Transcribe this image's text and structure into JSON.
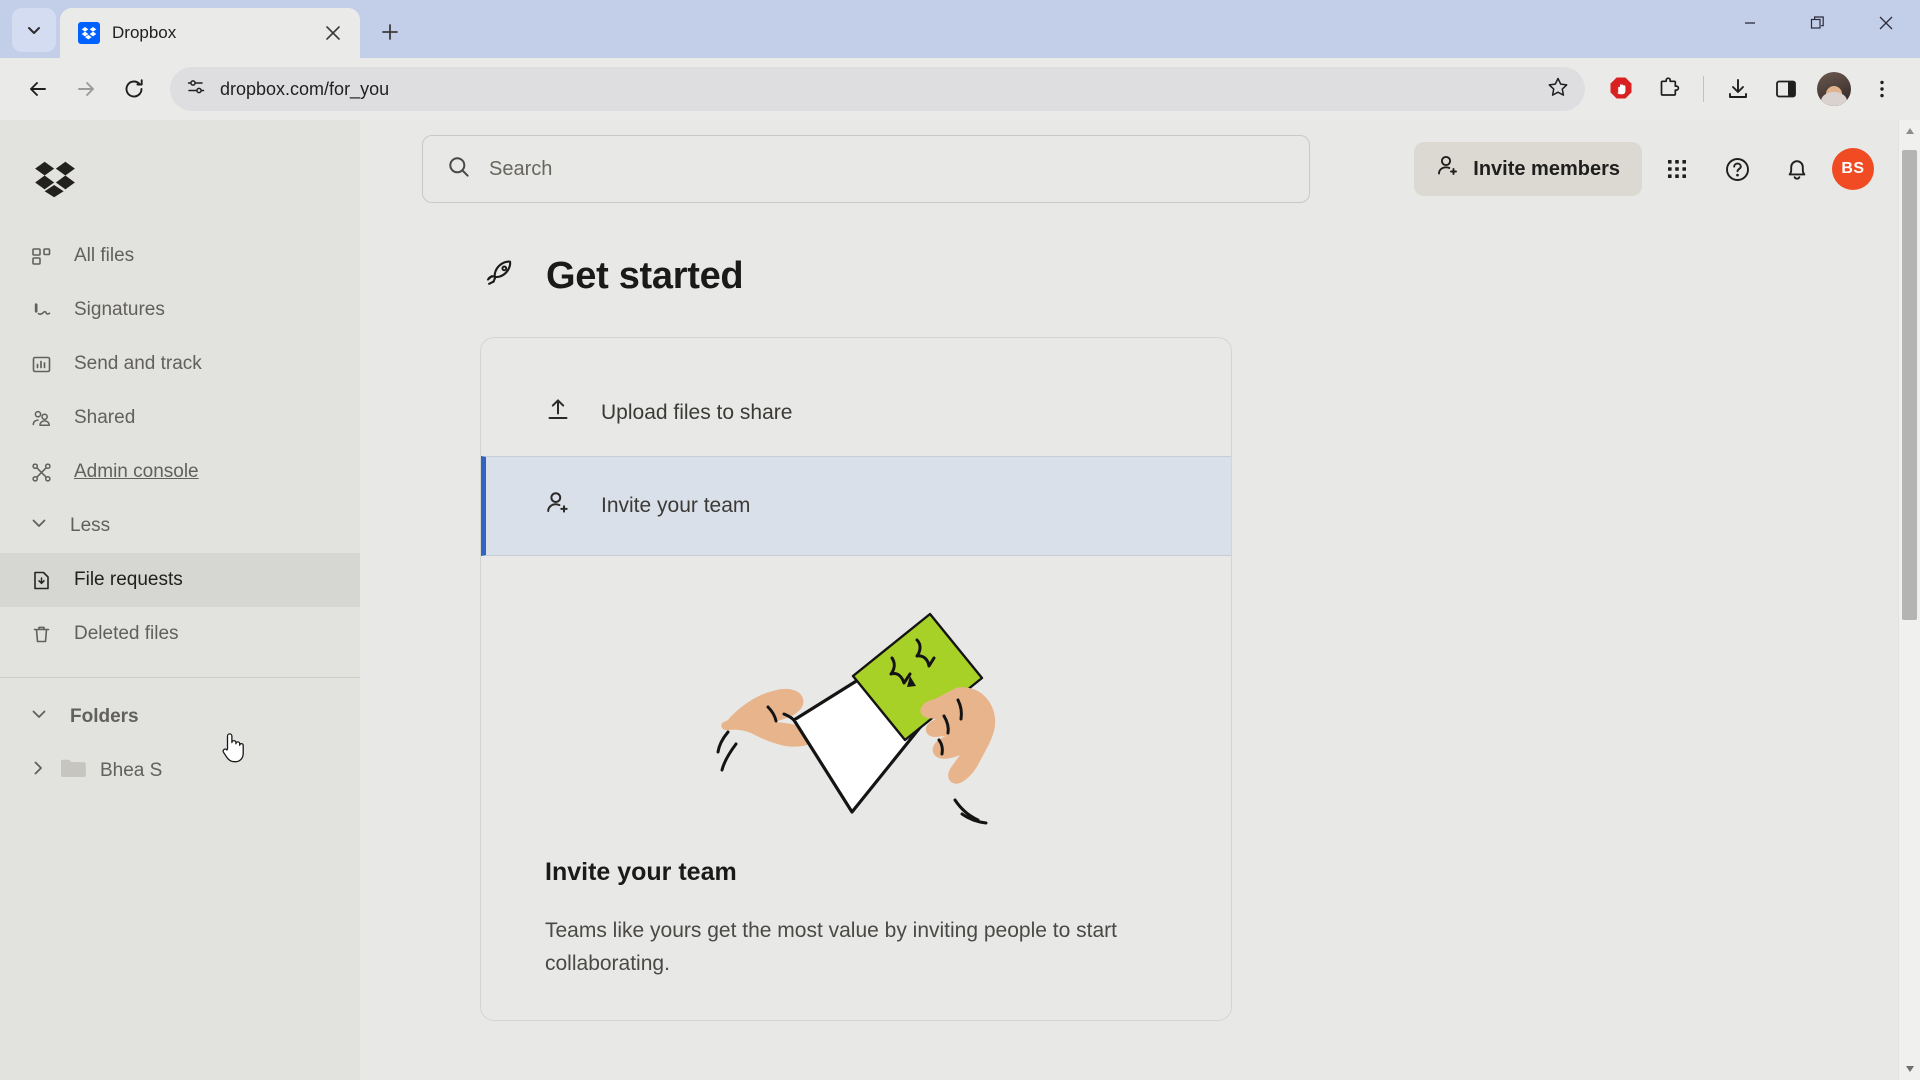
{
  "browser": {
    "tab": {
      "title": "Dropbox",
      "favicon": "dropbox-favicon"
    },
    "tab_list_icon": "chevron-down-icon",
    "new_tab_icon": "plus-icon",
    "close_tab_icon": "close-icon",
    "window_controls": {
      "minimize": "minimize-icon",
      "maximize": "restore-icon",
      "close": "close-icon"
    },
    "nav": {
      "back": "back-arrow-icon",
      "forward": "forward-arrow-icon",
      "reload": "reload-icon"
    },
    "omnibox": {
      "url": "dropbox.com/for_you",
      "site_info_icon": "site-settings-icon",
      "bookmark_icon": "star-icon"
    },
    "toolbar_icons": [
      "adblock-icon",
      "extensions-icon",
      "downloads-icon",
      "side-panel-icon",
      "profile-avatar",
      "chrome-menu-icon"
    ]
  },
  "sidebar": {
    "logo": "dropbox-logo",
    "items": [
      {
        "label": "All files",
        "icon": "all-files-icon",
        "state": "normal"
      },
      {
        "label": "Signatures",
        "icon": "signature-icon",
        "state": "normal"
      },
      {
        "label": "Send and track",
        "icon": "send-track-icon",
        "state": "normal"
      },
      {
        "label": "Shared",
        "icon": "shared-icon",
        "state": "normal"
      },
      {
        "label": "Admin console",
        "icon": "admin-icon",
        "state": "link"
      },
      {
        "label": "Less",
        "icon": "chevron-down-icon",
        "state": "toggle"
      },
      {
        "label": "File requests",
        "icon": "file-request-icon",
        "state": "hovered"
      },
      {
        "label": "Deleted files",
        "icon": "trash-icon",
        "state": "normal"
      }
    ],
    "folders_group": {
      "label": "Folders",
      "icon": "chevron-down-icon"
    },
    "folders": [
      {
        "label": "Bhea S",
        "icon": "folder-icon",
        "expander": "chevron-right-icon"
      }
    ]
  },
  "header": {
    "search": {
      "placeholder": "Search",
      "icon": "search-icon",
      "value": ""
    },
    "invite_members_label": "Invite members",
    "invite_members_icon": "person-add-icon",
    "apps_icon": "grid-apps-icon",
    "help_icon": "help-circle-icon",
    "notifications_icon": "bell-icon",
    "avatar_initials": "BS",
    "avatar_color": "#f04b23"
  },
  "main": {
    "page_title": "Get started",
    "page_title_icon": "rocket-icon",
    "tasks": [
      {
        "label": "Upload files to share",
        "icon": "upload-icon",
        "active": false
      },
      {
        "label": "Invite your team",
        "icon": "person-add-icon",
        "active": true
      }
    ],
    "detail": {
      "illustration": "hands-holding-envelope-illustration",
      "heading": "Invite your team",
      "body": "Teams like yours get the most value by inviting people to start collaborating."
    },
    "accent_color": "#3063c4",
    "active_task_bg": "#dae0ea"
  },
  "scrollbar": {
    "up_icon": "scroll-up-icon",
    "down_icon": "scroll-down-icon"
  }
}
